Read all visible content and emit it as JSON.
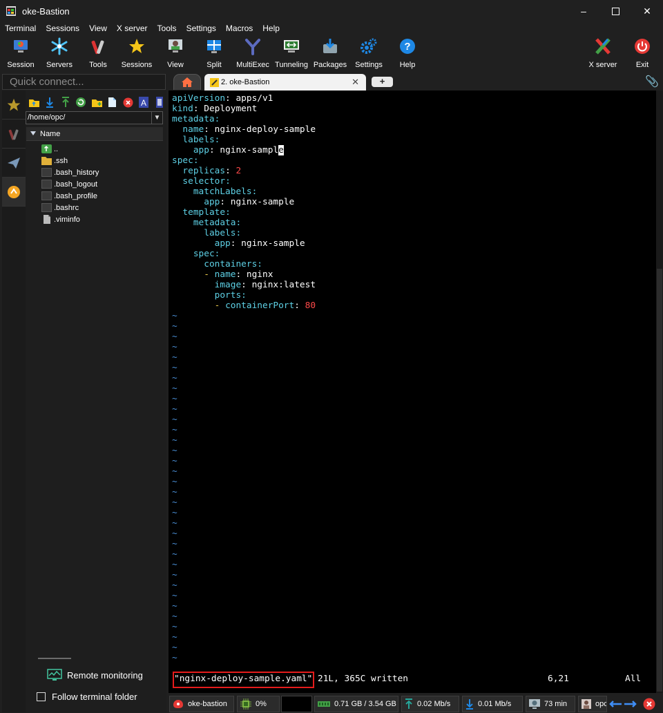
{
  "window": {
    "title": "oke-Bastion"
  },
  "menu": [
    "Terminal",
    "Sessions",
    "View",
    "X server",
    "Tools",
    "Settings",
    "Macros",
    "Help"
  ],
  "toolbar": {
    "session": "Session",
    "servers": "Servers",
    "tools": "Tools",
    "sessions": "Sessions",
    "view": "View",
    "split": "Split",
    "multiexec": "MultiExec",
    "tunneling": "Tunneling",
    "packages": "Packages",
    "settings": "Settings",
    "help": "Help",
    "xserver": "X server",
    "exit": "Exit"
  },
  "sidebar": {
    "quick_connect_placeholder": "Quick connect...",
    "path": "/home/opc/",
    "column_name": "Name",
    "files": [
      "..",
      ".ssh",
      ".bash_history",
      ".bash_logout",
      ".bash_profile",
      ".bashrc",
      ".viminfo"
    ],
    "remote_monitoring": "Remote monitoring",
    "follow_terminal_folder": "Follow terminal folder"
  },
  "tabs": {
    "active": "2. oke-Bastion",
    "add": "+"
  },
  "terminal": {
    "lines": [
      [
        [
          "k",
          "apiVersion"
        ],
        [
          "v",
          ": apps/v1"
        ]
      ],
      [
        [
          "k",
          "kind"
        ],
        [
          "v",
          ": Deployment"
        ]
      ],
      [
        [
          "k",
          "metadata"
        ],
        [
          "k",
          ":"
        ]
      ],
      [
        [
          "v",
          "  "
        ],
        [
          "k",
          "name"
        ],
        [
          "v",
          ": nginx-deploy-sample"
        ]
      ],
      [
        [
          "v",
          "  "
        ],
        [
          "k",
          "labels"
        ],
        [
          "k",
          ":"
        ]
      ],
      [
        [
          "v",
          "    "
        ],
        [
          "k",
          "app"
        ],
        [
          "v",
          ": nginx-sampl"
        ],
        [
          "cur",
          "e"
        ]
      ],
      [
        [
          "k",
          "spec"
        ],
        [
          "k",
          ":"
        ]
      ],
      [
        [
          "v",
          "  "
        ],
        [
          "k",
          "replicas"
        ],
        [
          "v",
          ": "
        ],
        [
          "n",
          "2"
        ]
      ],
      [
        [
          "v",
          "  "
        ],
        [
          "k",
          "selector"
        ],
        [
          "k",
          ":"
        ]
      ],
      [
        [
          "v",
          "    "
        ],
        [
          "k",
          "matchLabels"
        ],
        [
          "k",
          ":"
        ]
      ],
      [
        [
          "v",
          "      "
        ],
        [
          "k",
          "app"
        ],
        [
          "v",
          ": nginx-sample"
        ]
      ],
      [
        [
          "v",
          "  "
        ],
        [
          "k",
          "template"
        ],
        [
          "k",
          ":"
        ]
      ],
      [
        [
          "v",
          "    "
        ],
        [
          "k",
          "metadata"
        ],
        [
          "k",
          ":"
        ]
      ],
      [
        [
          "v",
          "      "
        ],
        [
          "k",
          "labels"
        ],
        [
          "k",
          ":"
        ]
      ],
      [
        [
          "v",
          "        "
        ],
        [
          "k",
          "app"
        ],
        [
          "v",
          ": nginx-sample"
        ]
      ],
      [
        [
          "v",
          "    "
        ],
        [
          "k",
          "spec"
        ],
        [
          "k",
          ":"
        ]
      ],
      [
        [
          "v",
          "      "
        ],
        [
          "k",
          "containers"
        ],
        [
          "k",
          ":"
        ]
      ],
      [
        [
          "v",
          "      "
        ],
        [
          "d",
          "- "
        ],
        [
          "k",
          "name"
        ],
        [
          "v",
          ": nginx"
        ]
      ],
      [
        [
          "v",
          "        "
        ],
        [
          "k",
          "image"
        ],
        [
          "v",
          ": nginx:latest"
        ]
      ],
      [
        [
          "v",
          "        "
        ],
        [
          "k",
          "ports"
        ],
        [
          "k",
          ":"
        ]
      ],
      [
        [
          "v",
          "        "
        ],
        [
          "d",
          "- "
        ],
        [
          "k",
          "containerPort"
        ],
        [
          "v",
          ": "
        ],
        [
          "n",
          "80"
        ]
      ]
    ],
    "tilde": "~",
    "tilde_count": 34,
    "status_msg": "\"nginx-deploy-sample.yaml\" 21L, 365C written",
    "cursor_pos": "6,21",
    "scroll_pos": "All"
  },
  "statusbar": {
    "session": "oke-bastion",
    "cpu": "0%",
    "memory": "0.71 GB / 3.54 GB",
    "upload": "0.02 Mb/s",
    "download": "0.01 Mb/s",
    "uptime": "73 min",
    "user": "opc"
  }
}
